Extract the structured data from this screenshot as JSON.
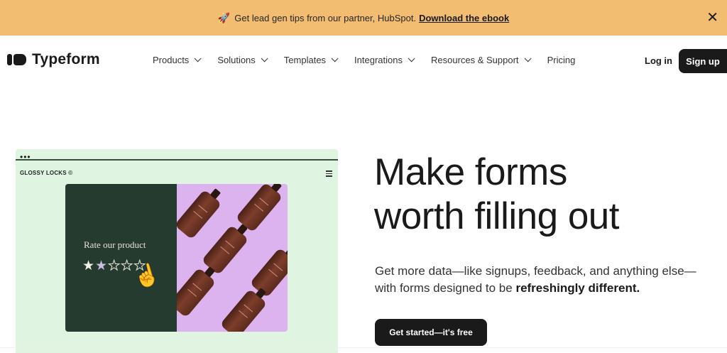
{
  "banner": {
    "icon": "rocket-icon",
    "text": "Get lead gen tips from our partner, HubSpot.",
    "link": "Download the ebook",
    "background": "#f3bd71"
  },
  "nav": {
    "logo_text": "Typeform",
    "items": [
      {
        "label": "Products"
      },
      {
        "label": "Solutions"
      },
      {
        "label": "Templates"
      },
      {
        "label": "Integrations"
      },
      {
        "label": "Resources & Support"
      },
      {
        "label": "Pricing"
      }
    ],
    "login": "Log in",
    "signup": "Sign up"
  },
  "hero": {
    "card": {
      "dots": "•••",
      "brand": "GLOSSY LOCKS ©",
      "prompt": "Rate our product",
      "rating": 1.5,
      "max_rating": 5
    },
    "headline_line1": "Make forms",
    "headline_line2": "worth filling out",
    "sub_plain": "Get more data—like signups, feedback, and anything else—with forms designed to be ",
    "sub_bold": "refreshingly different.",
    "cta": "Get started—it's free"
  }
}
